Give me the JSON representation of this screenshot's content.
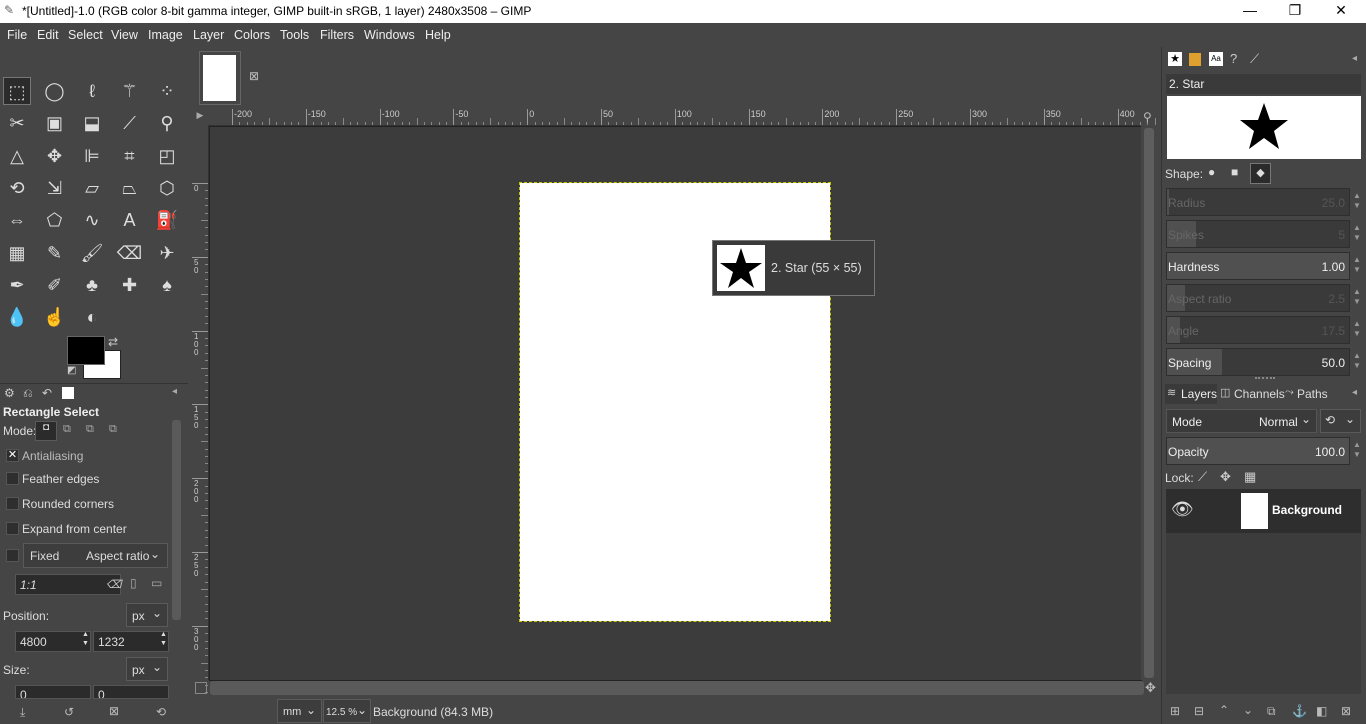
{
  "window": {
    "title": "*[Untitled]-1.0 (RGB color 8-bit gamma integer, GIMP built-in sRGB, 1 layer) 2480x3508 – GIMP",
    "minimize": "—",
    "restore": "❐",
    "close": "✕"
  },
  "menu": [
    "File",
    "Edit",
    "Select",
    "View",
    "Image",
    "Layer",
    "Colors",
    "Tools",
    "Filters",
    "Windows",
    "Help"
  ],
  "toolbox": {
    "tools": [
      {
        "name": "rect-select-icon",
        "glyph": "⬚"
      },
      {
        "name": "ellipse-select-icon",
        "glyph": "◯"
      },
      {
        "name": "free-select-icon",
        "glyph": "ℓ"
      },
      {
        "name": "fuzzy-select-icon",
        "glyph": "⚚"
      },
      {
        "name": "select-by-color-icon",
        "glyph": "⁘"
      },
      {
        "name": "scissors-select-icon",
        "glyph": "✂"
      },
      {
        "name": "foreground-select-icon",
        "glyph": "▣"
      },
      {
        "name": "paths-icon",
        "glyph": "⬓"
      },
      {
        "name": "color-picker-icon",
        "glyph": "⟋"
      },
      {
        "name": "zoom-icon",
        "glyph": "⚲"
      },
      {
        "name": "measure-icon",
        "glyph": "△"
      },
      {
        "name": "move-icon",
        "glyph": "✥"
      },
      {
        "name": "align-icon",
        "glyph": "⊫"
      },
      {
        "name": "crop-icon",
        "glyph": "⌗"
      },
      {
        "name": "unified-transform-icon",
        "glyph": "◰"
      },
      {
        "name": "rotate-icon",
        "glyph": "⟲"
      },
      {
        "name": "scale-icon",
        "glyph": "⇲"
      },
      {
        "name": "shear-icon",
        "glyph": "▱"
      },
      {
        "name": "perspective-icon",
        "glyph": "⏢"
      },
      {
        "name": "3d-transform-icon",
        "glyph": "⬡"
      },
      {
        "name": "warp-transform-icon",
        "glyph": "⇔"
      },
      {
        "name": "cage-transform-icon",
        "glyph": "⬠"
      },
      {
        "name": "warp-icon",
        "glyph": "∿"
      },
      {
        "name": "text-icon",
        "glyph": "A"
      },
      {
        "name": "bucket-fill-icon",
        "glyph": "⛽"
      },
      {
        "name": "gradient-icon",
        "glyph": "▦"
      },
      {
        "name": "pencil-icon",
        "glyph": "✎"
      },
      {
        "name": "paintbrush-icon",
        "glyph": "🖌"
      },
      {
        "name": "eraser-icon",
        "glyph": "⌫"
      },
      {
        "name": "airbrush-icon",
        "glyph": "✈"
      },
      {
        "name": "ink-icon",
        "glyph": "✒"
      },
      {
        "name": "mypaint-brush-icon",
        "glyph": "✐"
      },
      {
        "name": "clone-icon",
        "glyph": "♣"
      },
      {
        "name": "heal-icon",
        "glyph": "✚"
      },
      {
        "name": "perspective-clone-icon",
        "glyph": "♠"
      },
      {
        "name": "blur-icon",
        "glyph": "💧"
      },
      {
        "name": "smudge-icon",
        "glyph": "☝"
      },
      {
        "name": "dodge-burn-icon",
        "glyph": "◐"
      }
    ],
    "fg_color": "#000000",
    "bg_color": "#ffffff"
  },
  "tool_options": {
    "tabs_glyphs": [
      "⚙",
      "⎌",
      "↶"
    ],
    "title": "Rectangle Select",
    "mode_label": "Mode:",
    "antialiasing": "Antialiasing",
    "feather_edges": "Feather edges",
    "rounded_corners": "Rounded corners",
    "expand_from_center": "Expand from center",
    "fixed": "Fixed",
    "aspect_ratio": "Aspect ratio",
    "ratio_value": "1:1",
    "position_label": "Position:",
    "position_unit": "px",
    "position_x": "4800",
    "position_y": "1232",
    "size_label": "Size:",
    "size_unit": "px",
    "size_w": "0",
    "size_h": "0"
  },
  "ruler": {
    "h_labels": [
      "-200",
      "-150",
      "-100",
      "-50",
      "0",
      "50",
      "100",
      "150",
      "200",
      "250",
      "300",
      "350",
      "400"
    ],
    "v_labels": [
      "0",
      "5 0",
      "1 0 0",
      "1 5 0",
      "2 0 0",
      "2 5 0",
      "3 0 0"
    ]
  },
  "tooltip": {
    "text": "2. Star (55 × 55)"
  },
  "status": {
    "unit": "mm",
    "zoom": "12.5 %",
    "info": "Background (84.3 MB)"
  },
  "brushes": {
    "name": "2. Star",
    "shape_label": "Shape:",
    "sliders": [
      {
        "label": "Radius",
        "value": "25.0",
        "dim": true,
        "fill": 0.01
      },
      {
        "label": "Spikes",
        "value": "5",
        "dim": true,
        "fill": 0.16
      },
      {
        "label": "Hardness",
        "value": "1.00",
        "dim": false,
        "fill": 1.0
      },
      {
        "label": "Aspect ratio",
        "value": "2.5",
        "dim": true,
        "fill": 0.1
      },
      {
        "label": "Angle",
        "value": "17.5",
        "dim": true,
        "fill": 0.07
      },
      {
        "label": "Spacing",
        "value": "50.0",
        "dim": false,
        "fill": 0.3
      }
    ]
  },
  "layers": {
    "tabs": [
      "Layers",
      "Channels",
      "Paths"
    ],
    "mode_label": "Mode",
    "mode_value": "Normal",
    "opacity_label": "Opacity",
    "opacity_value": "100.0",
    "lock_label": "Lock:",
    "layer_name": "Background"
  }
}
